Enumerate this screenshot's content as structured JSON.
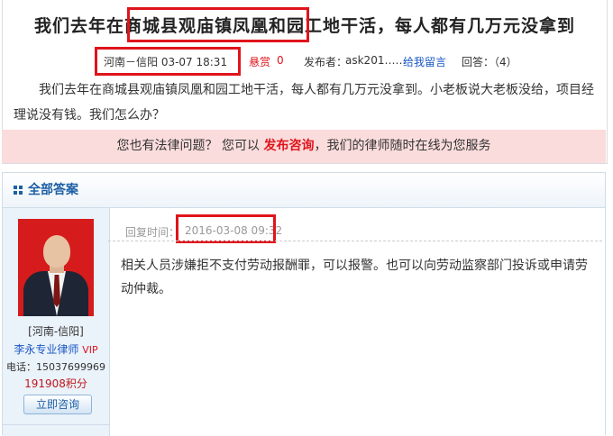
{
  "question": {
    "title": "我们去年在商城县观庙镇凤凰和园工地干活，每人都有几万元没拿到",
    "location_time": "河南－信阳   03-07 18:31",
    "reward_label": "悬赏",
    "reward_value": "0",
    "poster_label": "发布者：",
    "poster": "ask201……",
    "message_link": "给我留言",
    "reply_count": "回答：（4）",
    "body": "我们去年在商城县观庙镇凤凰和园工地干活，每人都有几万元没拿到。小老板说大老板没给，项目经理说没有钱。我们怎么办？"
  },
  "banner": {
    "text_before": "您也有法律问题？ 您可以 ",
    "action": "发布咨询",
    "text_after": "，我们的律师随时在线为您服务"
  },
  "answers": {
    "header": "全部答案",
    "items": [
      {
        "lawyer_location": "[河南-信阳]",
        "lawyer_name": "李永专业律师",
        "vip": "VIP",
        "phone": "电话：15037699969",
        "points": "191908积分",
        "consult_button": "立即咨询",
        "reply_time_label": "回复时间：",
        "reply_time": "2016-03-08 09:32",
        "reply_text": "相关人员涉嫌拒不支付劳动报酬罪，可以报警。也可以向劳动监察部门投诉或申请劳动仲裁。"
      }
    ]
  },
  "colors": {
    "highlight": "#e0141c",
    "link": "#1a57c5",
    "banner_bg": "#fbdcdc",
    "answers_accent": "#1d5fa5"
  }
}
